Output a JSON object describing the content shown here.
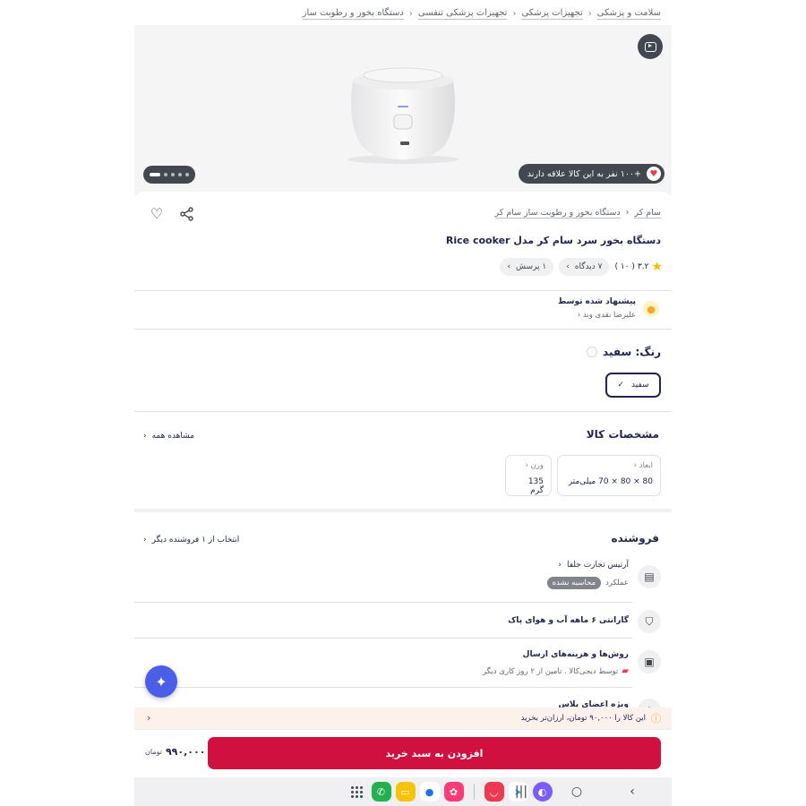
{
  "breadcrumb": [
    "سلامت و پزشکی",
    "تجهیزات پزشکی",
    "تجهیزات پزشکی تنفسی",
    "دستگاه بخور و رطوبت ساز"
  ],
  "hero": {
    "likes_text": "+۱۰۰ نفر به این کالا علاقه دارند",
    "gallery_dots": 5,
    "active_dot": 0
  },
  "product": {
    "brand": "سام کر",
    "category": "دستگاه بخور و رطوبت ساز سام کر",
    "title": "دستگاه بخور سرد سام کر مدل Rice cooker",
    "rating": "۳.۲",
    "rating_count": "( ۱۰ )",
    "reviews_chip": "۷ دیدگاه",
    "questions_chip": "۱ پرسش"
  },
  "recommendation": {
    "label": "پیشنهاد شده توسط",
    "by": "علیرضا نقدی وند"
  },
  "color": {
    "title": "رنگ: سفید",
    "selected": "سفید"
  },
  "specs": {
    "title": "مشخصات کالا",
    "see_all": "مشاهده همه",
    "items": [
      {
        "label": "ابعاد",
        "value": "80 × 80 × 70 میلی‌متر"
      },
      {
        "label": "وزن",
        "value": "135 گرم"
      }
    ]
  },
  "seller": {
    "title": "فروشنده",
    "other_sellers": "انتخاب از ۱ فروشنده دیگر",
    "name": "آرتیس تجارت جلفا",
    "performance_label": "عملکرد",
    "performance_badge": "محاسبه نشده",
    "warranty": "گارانتی ۶ ماهه آب و هوای پاک",
    "shipping_title": "روش‌ها و هزینه‌های ارسال",
    "shipping_detail": "توسط دیجی‌کالا . تامین از ۲ روز کاری دیگر",
    "club": "ویژه اعضای پلاس"
  },
  "notice": "این کالا را ۹۰,۰۰۰ تومان، ارزان‌تر بخرید",
  "buy": {
    "button": "افزودن به سبد خرید",
    "price": "۹۹۰,۰۰۰",
    "currency": "تومان"
  },
  "colors": {
    "primary": "#d0103e",
    "text": "#23254e",
    "fab": "#4b5ee8"
  }
}
